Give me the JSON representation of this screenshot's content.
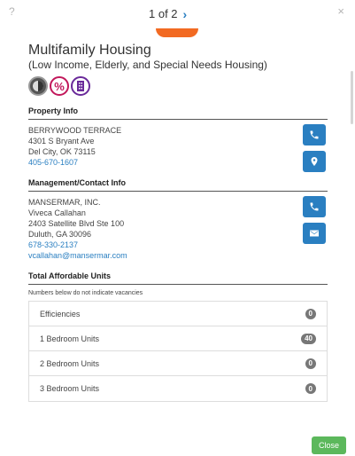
{
  "topbar": {
    "help": "?",
    "pager": "1 of 2",
    "next": "›",
    "close": "×"
  },
  "header": {
    "title": "Multifamily Housing",
    "subtitle": "(Low Income, Elderly, and Special Needs Housing)",
    "badges": [
      {
        "icon": "elderly-icon"
      },
      {
        "icon": "percent-icon",
        "label": "%",
        "color": "#c2185b"
      },
      {
        "icon": "building-icon",
        "color": "#6a2a9a"
      }
    ]
  },
  "property": {
    "heading": "Property Info",
    "name": "BERRYWOOD TERRACE",
    "address": "4301 S Bryant Ave",
    "city": "Del City, OK 73115",
    "phone": "405-670-1607"
  },
  "management": {
    "heading": "Management/Contact Info",
    "company": "MANSERMAR, INC.",
    "contact": "Viveca Callahan",
    "address": "2403 Satellite Blvd Ste 100",
    "city": "Duluth, GA 30096",
    "phone": "678-330-2137",
    "email": "vcallahan@mansermar.com"
  },
  "units": {
    "heading": "Total Affordable Units",
    "note": "Numbers below do not indicate vacancies",
    "rows": [
      {
        "label": "Efficiencies",
        "count": "0"
      },
      {
        "label": "1 Bedroom Units",
        "count": "40"
      },
      {
        "label": "2 Bedroom Units",
        "count": "0"
      },
      {
        "label": "3 Bedroom Units",
        "count": "0"
      }
    ]
  },
  "footer": {
    "close_label": "Close"
  },
  "colors": {
    "accent": "#2a7fc1",
    "orange": "#f26a22",
    "success": "#5cb85c"
  }
}
